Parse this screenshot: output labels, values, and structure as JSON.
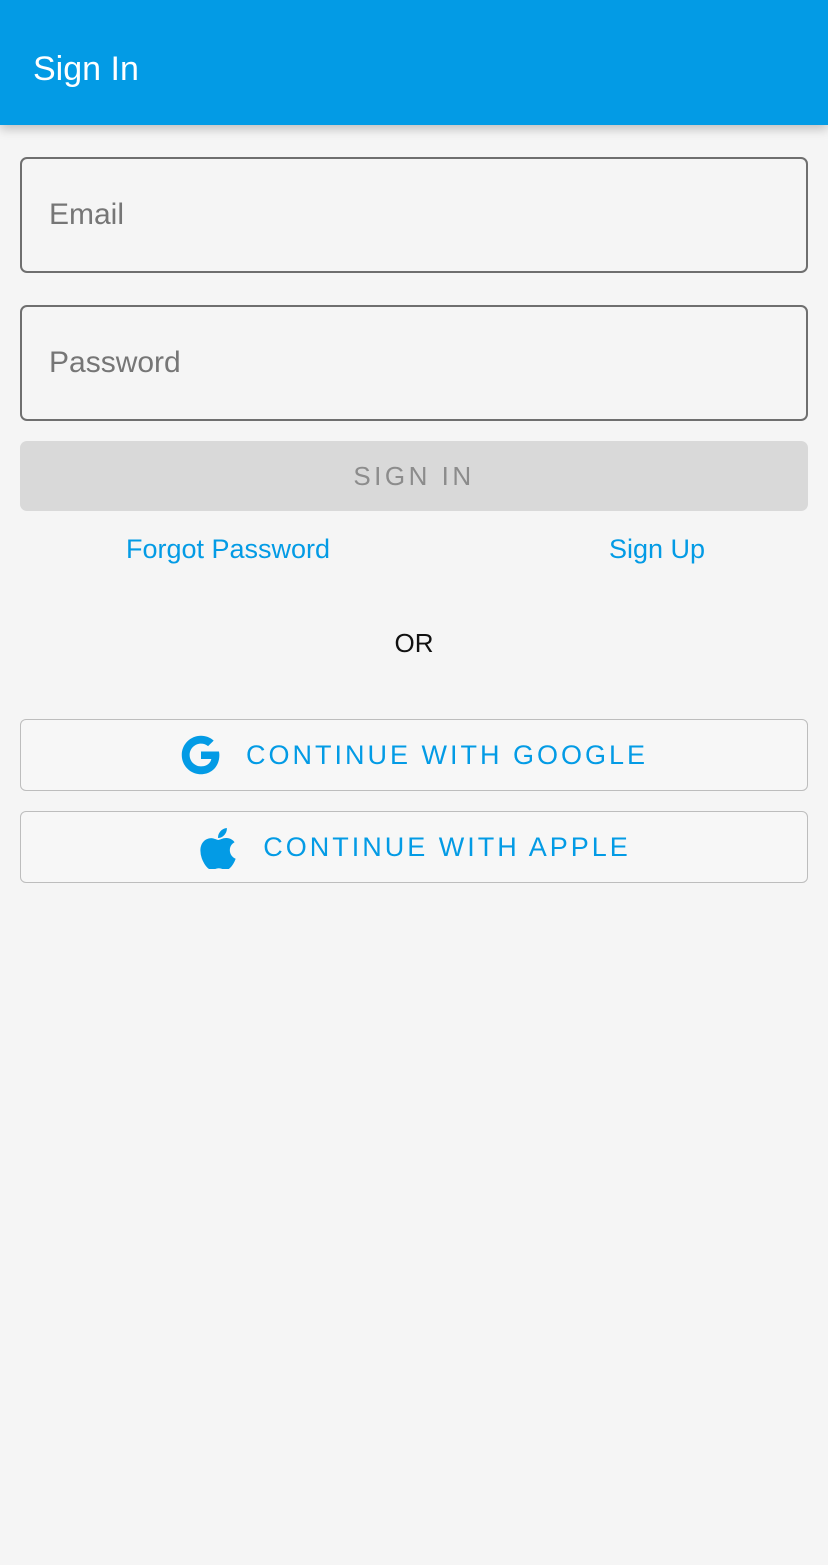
{
  "app_bar": {
    "title": "Sign In"
  },
  "form": {
    "email": {
      "placeholder": "Email",
      "value": ""
    },
    "password": {
      "placeholder": "Password",
      "value": ""
    },
    "sign_in_label": "SIGN IN"
  },
  "links": {
    "forgot_password": "Forgot Password",
    "sign_up": "Sign Up"
  },
  "divider_text": "OR",
  "social": {
    "google": {
      "label": "CONTINUE WITH GOOGLE",
      "icon": "google-icon"
    },
    "apple": {
      "label": "CONTINUE WITH APPLE",
      "icon": "apple-icon"
    }
  },
  "colors": {
    "primary": "#039be5",
    "background": "#f5f5f5",
    "disabled_button": "#d9d9d9",
    "disabled_text": "#8c8c8c"
  }
}
